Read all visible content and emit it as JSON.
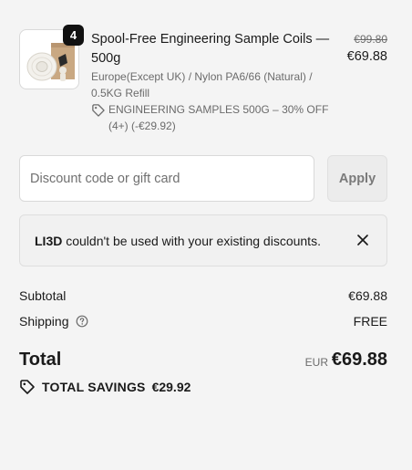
{
  "product": {
    "quantity": "4",
    "title": "Spool-Free Engineering Sample Coils — 500g",
    "variant": "Europe(Except UK) / Nylon PA6/66  (Natural)   / 0.5KG Refill",
    "discount_text": "ENGINEERING SAMPLES 500G – 30% OFF (4+) (-€29.92)",
    "price_original": "€99.80",
    "price_final": "€69.88",
    "icons": {
      "discount": "tag-icon"
    }
  },
  "discount_form": {
    "placeholder": "Discount code or gift card",
    "value": "",
    "apply_label": "Apply"
  },
  "notice": {
    "code": "LI3D",
    "message": " couldn't be used with your existing discounts.",
    "icons": {
      "close": "close-icon"
    }
  },
  "summary": {
    "subtotal_label": "Subtotal",
    "subtotal_value": "€69.88",
    "shipping_label": "Shipping",
    "shipping_value": "FREE",
    "total_label": "Total",
    "currency": "EUR",
    "total_value": "€69.88",
    "savings_label": "TOTAL SAVINGS",
    "savings_value": "€29.92",
    "icons": {
      "shipping_help": "question-circle-icon",
      "savings": "tag-icon"
    }
  },
  "colors": {
    "background": "#f4f4f4",
    "text": "#1a1a1a",
    "muted": "#6b6b6b",
    "badge": "#111111"
  }
}
